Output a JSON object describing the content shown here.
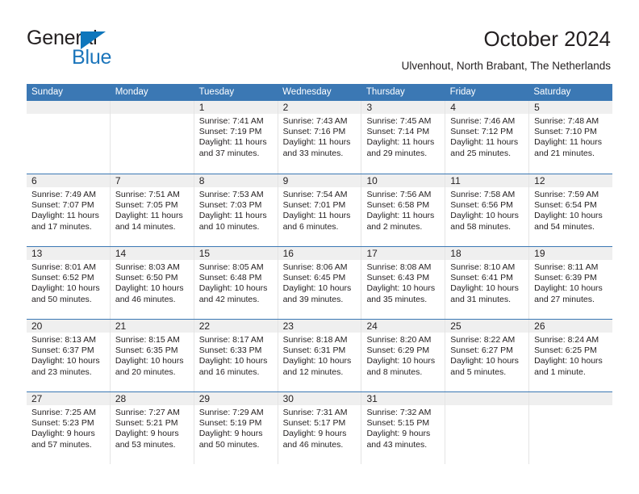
{
  "brand": {
    "name_top": "General",
    "name_bottom": "Blue",
    "triangle_color": "#0e76bc",
    "text_color": "#231f20",
    "blue_color": "#1b75bb",
    "logo_icon": "triangle-flag-icon"
  },
  "header": {
    "title": "October 2024",
    "subtitle": "Ulvenhout, North Brabant, The Netherlands"
  },
  "theme": {
    "header_bar_color": "#3b78b4",
    "daynum_band_color": "#efefef",
    "separator_color": "#3b78b4",
    "text_color": "#231f20"
  },
  "weekdays": [
    "Sunday",
    "Monday",
    "Tuesday",
    "Wednesday",
    "Thursday",
    "Friday",
    "Saturday"
  ],
  "weeks": [
    [
      {
        "day": "",
        "sunrise": "",
        "sunset": "",
        "daylight": "",
        "empty": true
      },
      {
        "day": "",
        "sunrise": "",
        "sunset": "",
        "daylight": "",
        "empty": true
      },
      {
        "day": "1",
        "sunrise": "Sunrise: 7:41 AM",
        "sunset": "Sunset: 7:19 PM",
        "daylight": "Daylight: 11 hours and 37 minutes."
      },
      {
        "day": "2",
        "sunrise": "Sunrise: 7:43 AM",
        "sunset": "Sunset: 7:16 PM",
        "daylight": "Daylight: 11 hours and 33 minutes."
      },
      {
        "day": "3",
        "sunrise": "Sunrise: 7:45 AM",
        "sunset": "Sunset: 7:14 PM",
        "daylight": "Daylight: 11 hours and 29 minutes."
      },
      {
        "day": "4",
        "sunrise": "Sunrise: 7:46 AM",
        "sunset": "Sunset: 7:12 PM",
        "daylight": "Daylight: 11 hours and 25 minutes."
      },
      {
        "day": "5",
        "sunrise": "Sunrise: 7:48 AM",
        "sunset": "Sunset: 7:10 PM",
        "daylight": "Daylight: 11 hours and 21 minutes."
      }
    ],
    [
      {
        "day": "6",
        "sunrise": "Sunrise: 7:49 AM",
        "sunset": "Sunset: 7:07 PM",
        "daylight": "Daylight: 11 hours and 17 minutes."
      },
      {
        "day": "7",
        "sunrise": "Sunrise: 7:51 AM",
        "sunset": "Sunset: 7:05 PM",
        "daylight": "Daylight: 11 hours and 14 minutes."
      },
      {
        "day": "8",
        "sunrise": "Sunrise: 7:53 AM",
        "sunset": "Sunset: 7:03 PM",
        "daylight": "Daylight: 11 hours and 10 minutes."
      },
      {
        "day": "9",
        "sunrise": "Sunrise: 7:54 AM",
        "sunset": "Sunset: 7:01 PM",
        "daylight": "Daylight: 11 hours and 6 minutes."
      },
      {
        "day": "10",
        "sunrise": "Sunrise: 7:56 AM",
        "sunset": "Sunset: 6:58 PM",
        "daylight": "Daylight: 11 hours and 2 minutes."
      },
      {
        "day": "11",
        "sunrise": "Sunrise: 7:58 AM",
        "sunset": "Sunset: 6:56 PM",
        "daylight": "Daylight: 10 hours and 58 minutes."
      },
      {
        "day": "12",
        "sunrise": "Sunrise: 7:59 AM",
        "sunset": "Sunset: 6:54 PM",
        "daylight": "Daylight: 10 hours and 54 minutes."
      }
    ],
    [
      {
        "day": "13",
        "sunrise": "Sunrise: 8:01 AM",
        "sunset": "Sunset: 6:52 PM",
        "daylight": "Daylight: 10 hours and 50 minutes."
      },
      {
        "day": "14",
        "sunrise": "Sunrise: 8:03 AM",
        "sunset": "Sunset: 6:50 PM",
        "daylight": "Daylight: 10 hours and 46 minutes."
      },
      {
        "day": "15",
        "sunrise": "Sunrise: 8:05 AM",
        "sunset": "Sunset: 6:48 PM",
        "daylight": "Daylight: 10 hours and 42 minutes."
      },
      {
        "day": "16",
        "sunrise": "Sunrise: 8:06 AM",
        "sunset": "Sunset: 6:45 PM",
        "daylight": "Daylight: 10 hours and 39 minutes."
      },
      {
        "day": "17",
        "sunrise": "Sunrise: 8:08 AM",
        "sunset": "Sunset: 6:43 PM",
        "daylight": "Daylight: 10 hours and 35 minutes."
      },
      {
        "day": "18",
        "sunrise": "Sunrise: 8:10 AM",
        "sunset": "Sunset: 6:41 PM",
        "daylight": "Daylight: 10 hours and 31 minutes."
      },
      {
        "day": "19",
        "sunrise": "Sunrise: 8:11 AM",
        "sunset": "Sunset: 6:39 PM",
        "daylight": "Daylight: 10 hours and 27 minutes."
      }
    ],
    [
      {
        "day": "20",
        "sunrise": "Sunrise: 8:13 AM",
        "sunset": "Sunset: 6:37 PM",
        "daylight": "Daylight: 10 hours and 23 minutes."
      },
      {
        "day": "21",
        "sunrise": "Sunrise: 8:15 AM",
        "sunset": "Sunset: 6:35 PM",
        "daylight": "Daylight: 10 hours and 20 minutes."
      },
      {
        "day": "22",
        "sunrise": "Sunrise: 8:17 AM",
        "sunset": "Sunset: 6:33 PM",
        "daylight": "Daylight: 10 hours and 16 minutes."
      },
      {
        "day": "23",
        "sunrise": "Sunrise: 8:18 AM",
        "sunset": "Sunset: 6:31 PM",
        "daylight": "Daylight: 10 hours and 12 minutes."
      },
      {
        "day": "24",
        "sunrise": "Sunrise: 8:20 AM",
        "sunset": "Sunset: 6:29 PM",
        "daylight": "Daylight: 10 hours and 8 minutes."
      },
      {
        "day": "25",
        "sunrise": "Sunrise: 8:22 AM",
        "sunset": "Sunset: 6:27 PM",
        "daylight": "Daylight: 10 hours and 5 minutes."
      },
      {
        "day": "26",
        "sunrise": "Sunrise: 8:24 AM",
        "sunset": "Sunset: 6:25 PM",
        "daylight": "Daylight: 10 hours and 1 minute."
      }
    ],
    [
      {
        "day": "27",
        "sunrise": "Sunrise: 7:25 AM",
        "sunset": "Sunset: 5:23 PM",
        "daylight": "Daylight: 9 hours and 57 minutes."
      },
      {
        "day": "28",
        "sunrise": "Sunrise: 7:27 AM",
        "sunset": "Sunset: 5:21 PM",
        "daylight": "Daylight: 9 hours and 53 minutes."
      },
      {
        "day": "29",
        "sunrise": "Sunrise: 7:29 AM",
        "sunset": "Sunset: 5:19 PM",
        "daylight": "Daylight: 9 hours and 50 minutes."
      },
      {
        "day": "30",
        "sunrise": "Sunrise: 7:31 AM",
        "sunset": "Sunset: 5:17 PM",
        "daylight": "Daylight: 9 hours and 46 minutes."
      },
      {
        "day": "31",
        "sunrise": "Sunrise: 7:32 AM",
        "sunset": "Sunset: 5:15 PM",
        "daylight": "Daylight: 9 hours and 43 minutes."
      },
      {
        "day": "",
        "sunrise": "",
        "sunset": "",
        "daylight": "",
        "empty": true
      },
      {
        "day": "",
        "sunrise": "",
        "sunset": "",
        "daylight": "",
        "empty": true
      }
    ]
  ]
}
